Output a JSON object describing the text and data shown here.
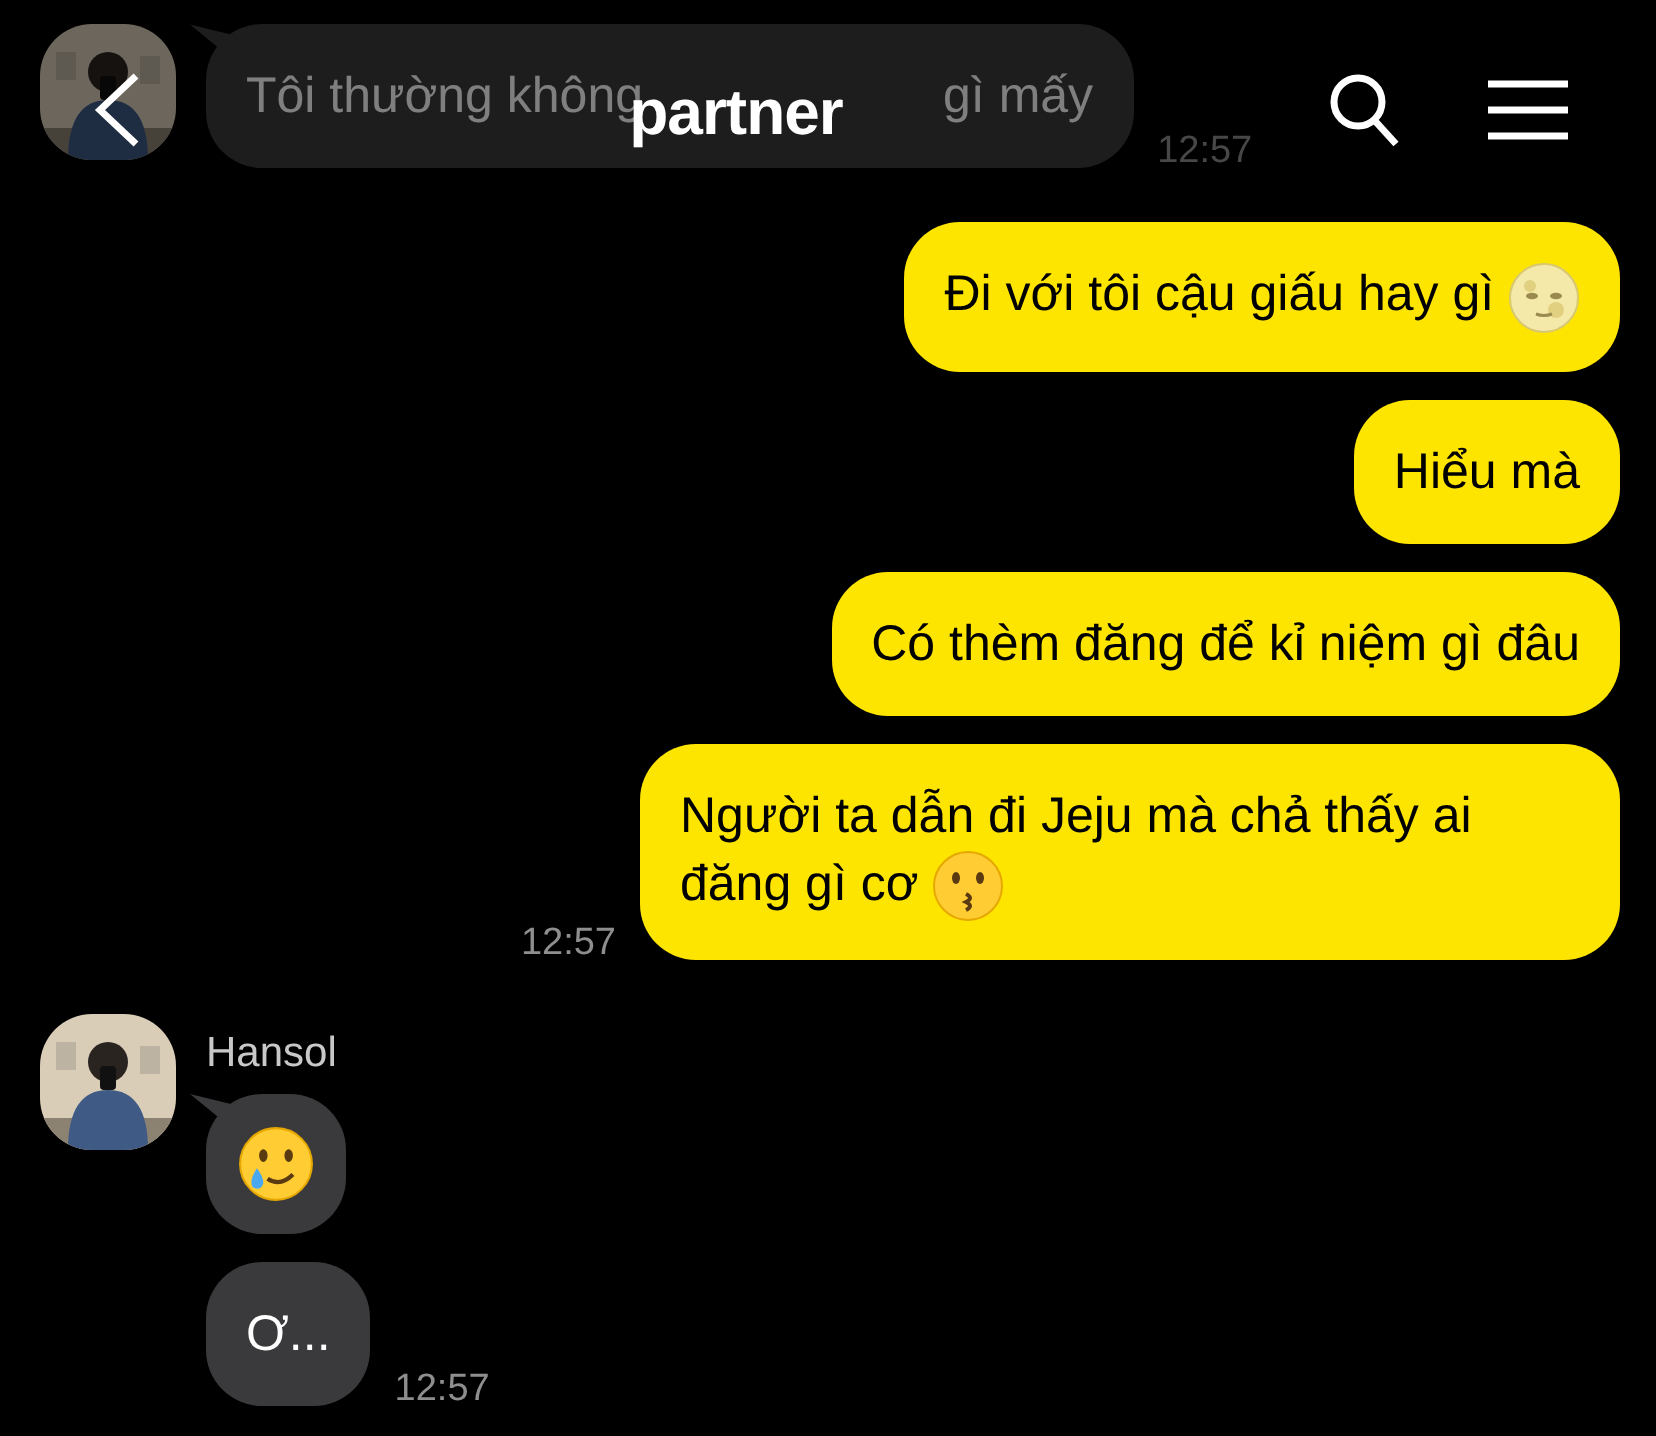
{
  "header": {
    "title": "partner"
  },
  "groups": [
    {
      "kind": "received",
      "time": "12:57",
      "messages": [
        {
          "text_parts": [
            "Tôi thường không",
            "gì mấy"
          ]
        }
      ]
    },
    {
      "kind": "sent",
      "time": "12:57",
      "messages": [
        {
          "text": "Đi với tôi cậu giấu hay gì",
          "kind": "moon"
        },
        {
          "text": "Hiểu mà"
        },
        {
          "text": "Có thèm đăng để kỉ niệm gì đâu"
        },
        {
          "text": "Người ta dẫn đi Jeju mà chả thấy ai đăng gì cơ",
          "kind": "kiss"
        }
      ]
    },
    {
      "kind": "received",
      "sender": "Hansol",
      "time": "12:57",
      "messages": [
        {
          "kind": "tear"
        },
        {
          "text": "Ơ..."
        }
      ]
    }
  ]
}
